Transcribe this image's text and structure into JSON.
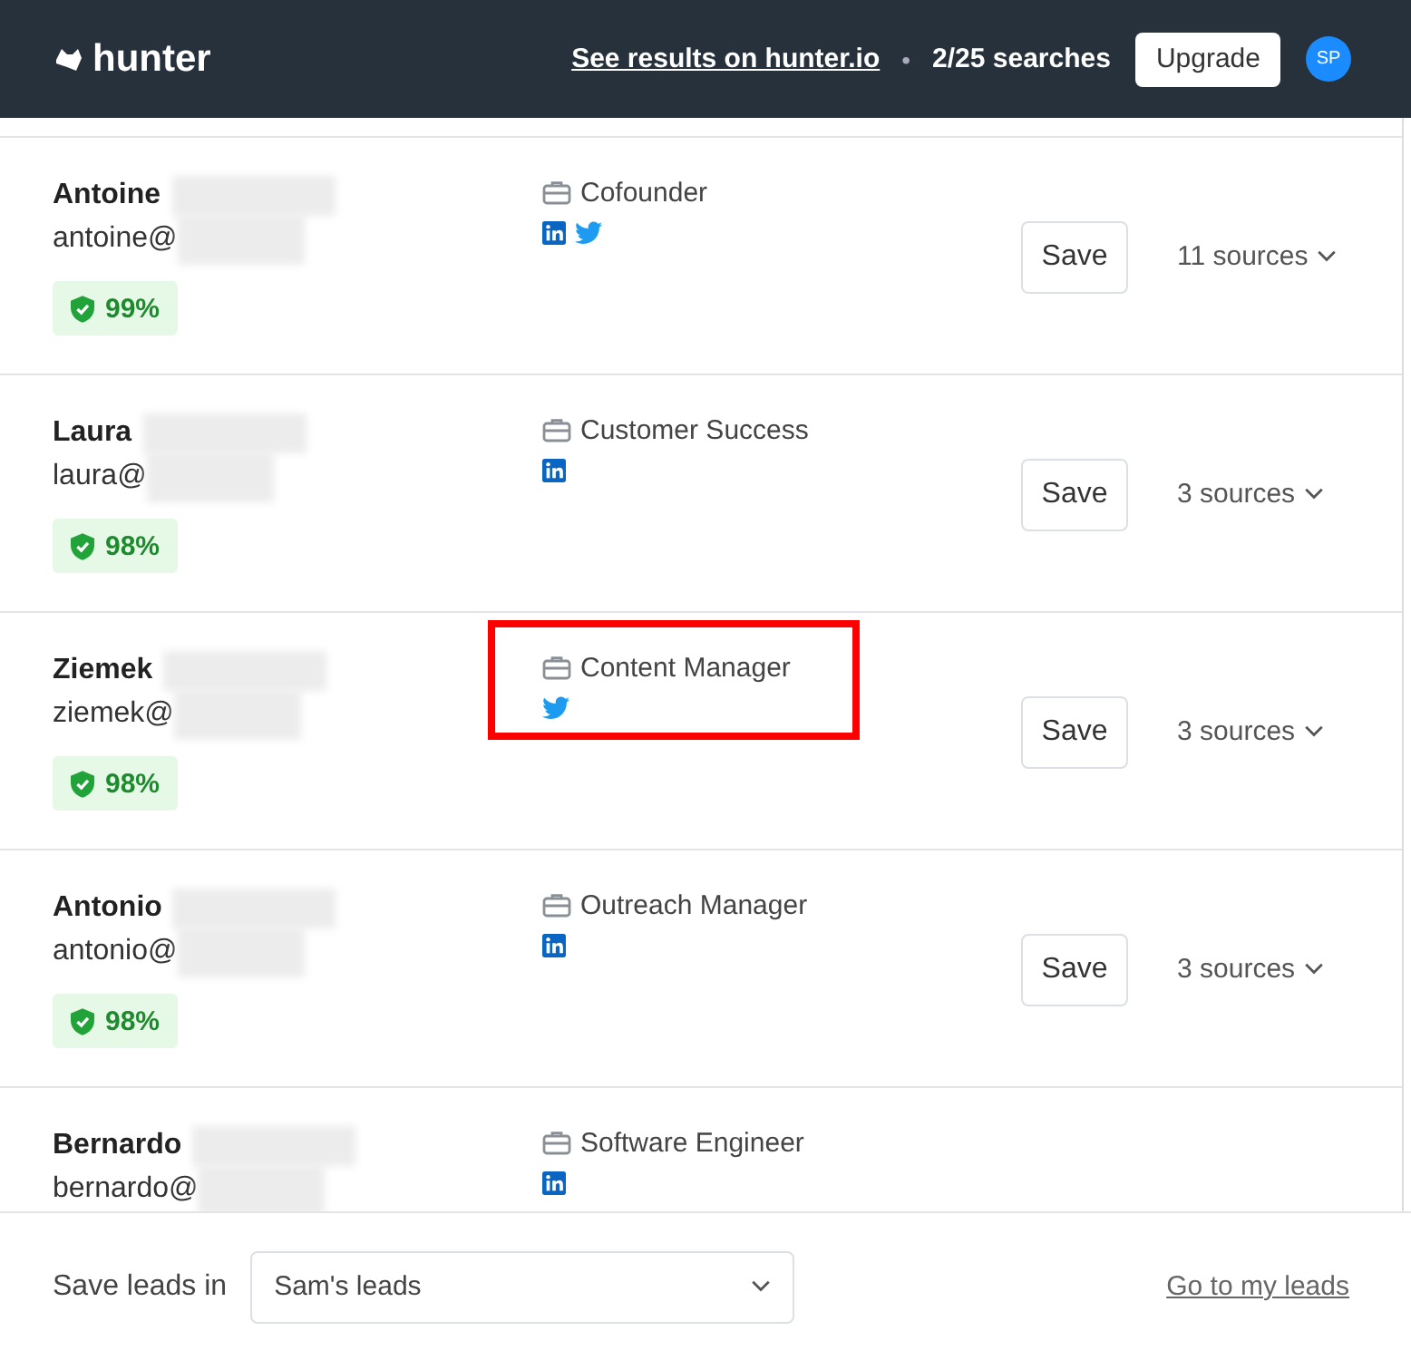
{
  "header": {
    "logo": "hunter",
    "link": "See results on hunter.io",
    "separator": "•",
    "searches": "2/25 searches",
    "upgrade_button": "Upgrade",
    "avatar": "SP"
  },
  "leads": [
    {
      "first_name": "Antoine",
      "email_prefix": "antoine@",
      "score": "99%",
      "position": "Cofounder",
      "socials": [
        {
          "kind": "linkedin"
        },
        {
          "kind": "twitter"
        }
      ],
      "save_button": "Save",
      "sources": "11 sources",
      "highlighted": false
    },
    {
      "first_name": "Laura",
      "email_prefix": "laura@",
      "score": "98%",
      "position": "Customer Success",
      "socials": [
        {
          "kind": "linkedin"
        }
      ],
      "save_button": "Save",
      "sources": "3 sources",
      "highlighted": false
    },
    {
      "first_name": "Ziemek",
      "email_prefix": "ziemek@",
      "score": "98%",
      "position": "Content Manager",
      "socials": [
        {
          "kind": "twitter"
        }
      ],
      "save_button": "Save",
      "sources": "3 sources",
      "highlighted": true
    },
    {
      "first_name": "Antonio",
      "email_prefix": "antonio@",
      "score": "98%",
      "position": "Outreach Manager",
      "socials": [
        {
          "kind": "linkedin"
        }
      ],
      "save_button": "Save",
      "sources": "3 sources",
      "highlighted": false
    },
    {
      "first_name": "Bernardo",
      "email_prefix": "bernardo@",
      "position": "Software Engineer",
      "socials": [
        {
          "kind": "linkedin"
        }
      ],
      "highlighted": false
    }
  ],
  "footer": {
    "label": "Save leads in",
    "list_select": {
      "value": "Sam's leads"
    },
    "link": "Go to my leads"
  }
}
